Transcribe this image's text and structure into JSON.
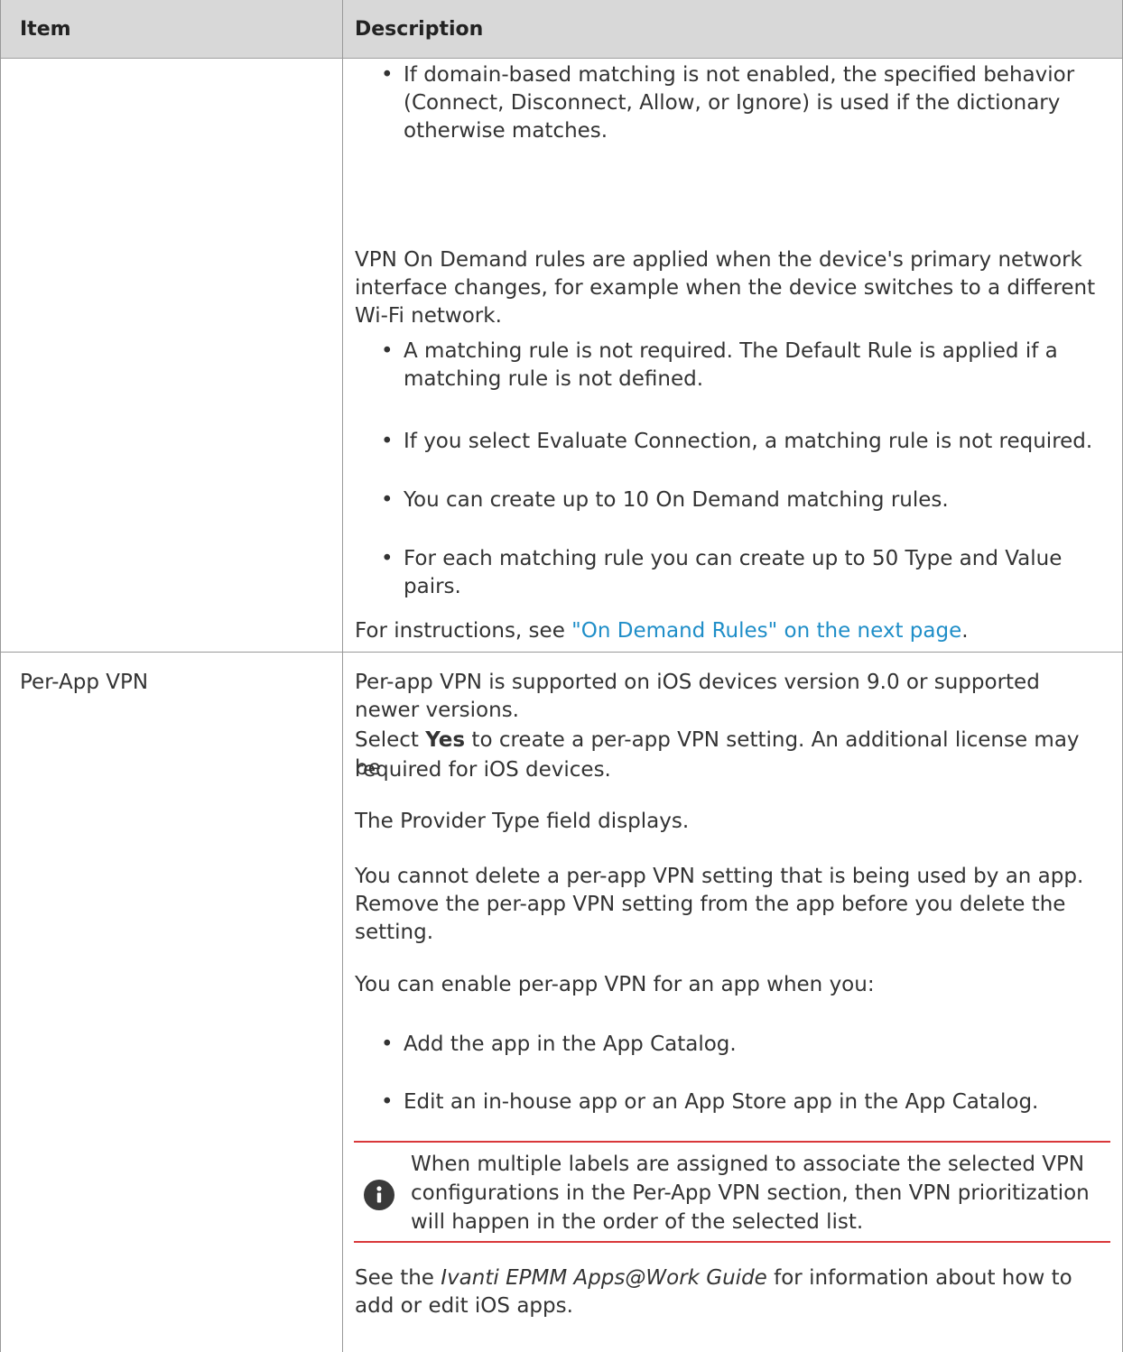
{
  "table": {
    "headers": [
      "Item",
      "Description"
    ]
  },
  "row1": {
    "bullet_domain": "If domain-based matching is not enabled, the specified behavior (Connect, Disconnect, Allow, or Ignore) is used if the dictionary otherwise matches.",
    "para_vpn": "VPN On Demand rules are applied when the device's primary network interface changes, for example when the device switches to a different Wi-Fi network.",
    "bullets": [
      "A matching rule is not required. The Default Rule is applied if a matching rule is not defined.",
      "If you select Evaluate Connection, a matching rule is not required.",
      "You can create up to 10 On Demand matching rules.",
      "For each matching rule you can create up to 50 Type and Value pairs."
    ],
    "instructions_prefix": "For instructions, see ",
    "instructions_link": "\"On Demand Rules\" on the next page",
    "instructions_suffix": "."
  },
  "row2": {
    "item": "Per-App VPN",
    "para_supported": "Per-app VPN is supported on iOS devices version 9.0 or supported newer versions.",
    "select_prefix": "Select ",
    "select_bold": "Yes",
    "select_rest": " to create a per-app VPN setting. An additional license may be",
    "select_line2": "required for iOS devices.",
    "para_provider": "The Provider Type field displays.",
    "para_delete": "You cannot delete a per-app VPN setting that is being used by an app. Remove the per-app VPN setting from the app before you delete the setting.",
    "para_enable": "You can enable per-app VPN for an app when you:",
    "bullets": [
      "Add the app in the App Catalog.",
      "Edit an in-house app or an App Store app in the App Catalog."
    ],
    "note": "When multiple labels are assigned to associate the selected VPN configurations in the Per-App VPN section, then VPN prioritization will happen in the order of the selected list.",
    "see_prefix": "See the ",
    "see_italic": "Ivanti EPMM Apps@Work Guide",
    "see_rest": " for information about how to add or edit iOS apps."
  },
  "icons": {
    "note": "info-icon",
    "bullet": "bullet-dot"
  },
  "colors": {
    "header_bg": "#d8d8d8",
    "link": "#1f8ec8",
    "note_rule": "#d9383a",
    "info_icon": "#3a3a3a"
  }
}
